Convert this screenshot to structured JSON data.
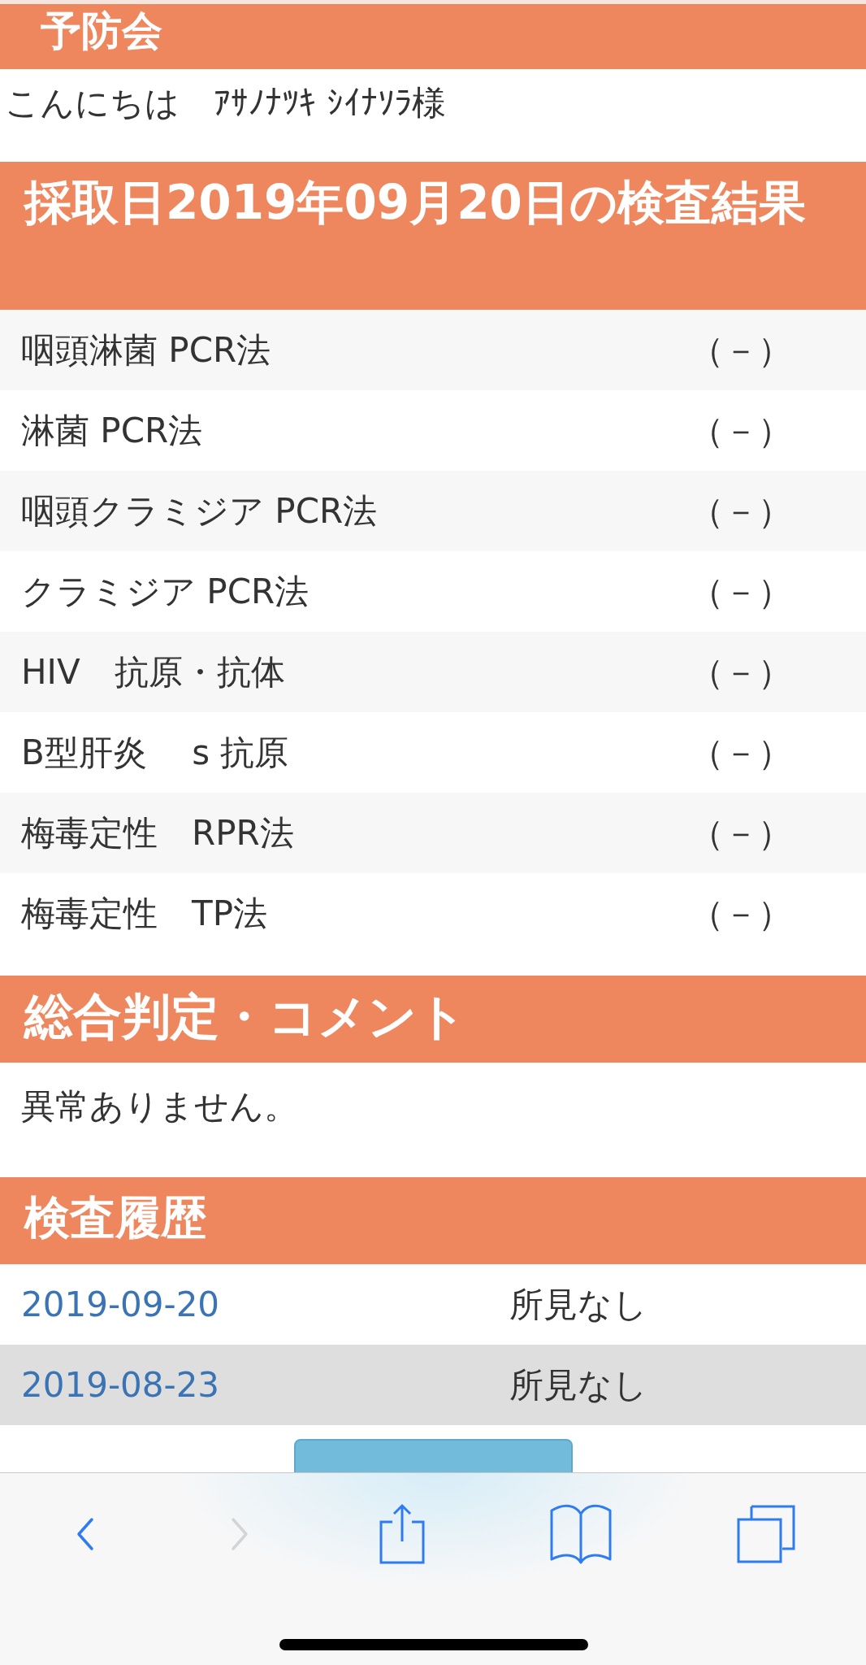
{
  "org_header": {
    "title": "予防会"
  },
  "greeting": {
    "text": "こんにちは　ｱｻﾉﾅﾂｷ ｼｲﾅｿﾗ様"
  },
  "results": {
    "title": "採取日2019年09月20日の検査結果",
    "rows": [
      {
        "test": "咽頭淋菌 PCR法",
        "result": "（－）"
      },
      {
        "test": "淋菌 PCR法",
        "result": "（－）"
      },
      {
        "test": "咽頭クラミジア PCR法",
        "result": "（－）"
      },
      {
        "test": "クラミジア PCR法",
        "result": "（－）"
      },
      {
        "test": "HIV　抗原・抗体",
        "result": "（－）"
      },
      {
        "test": "B型肝炎　 s 抗原",
        "result": "（－）"
      },
      {
        "test": "梅毒定性　RPR法",
        "result": "（－）"
      },
      {
        "test": "梅毒定性　TP法",
        "result": "（－）"
      }
    ]
  },
  "comment": {
    "title": "総合判定・コメント",
    "text": "異常ありません。"
  },
  "history": {
    "title": "検査履歴",
    "rows": [
      {
        "date": "2019-09-20",
        "finding": "所見なし"
      },
      {
        "date": "2019-08-23",
        "finding": "所見なし"
      }
    ]
  },
  "toolbar": {
    "buttons": [
      {
        "kind": "back",
        "disabled": false
      },
      {
        "kind": "forward",
        "disabled": true
      },
      {
        "kind": "share",
        "disabled": false
      },
      {
        "kind": "bookmarks",
        "disabled": false
      },
      {
        "kind": "tabs",
        "disabled": false
      }
    ]
  }
}
